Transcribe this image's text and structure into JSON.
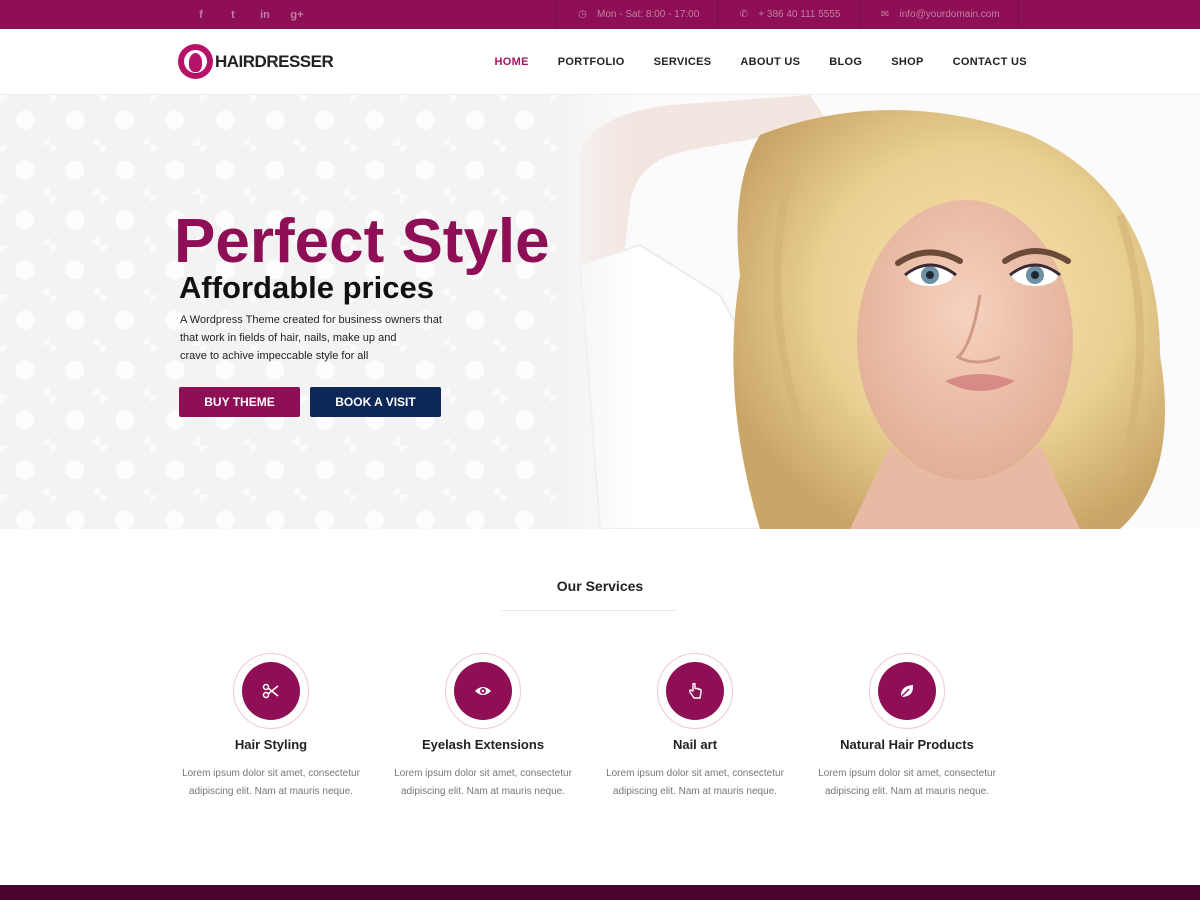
{
  "topbar": {
    "social": [
      {
        "icon": "facebook-icon",
        "glyph": "f"
      },
      {
        "icon": "twitter-icon",
        "glyph": "t"
      },
      {
        "icon": "linkedin-icon",
        "glyph": "in"
      },
      {
        "icon": "google-plus-icon",
        "glyph": "g+"
      }
    ],
    "hours": "Mon - Sat: 8:00 - 17:00",
    "phone": "+ 386 40 111 5555",
    "email": "info@yourdomain.com"
  },
  "header": {
    "logo_text": "HAIRDRESSER",
    "nav": [
      "HOME",
      "PORTFOLIO",
      "SERVICES",
      "ABOUT US",
      "BLOG",
      "SHOP",
      "CONTACT US"
    ],
    "active_nav": "HOME"
  },
  "hero": {
    "title": "Perfect Style",
    "subtitle": "Affordable prices",
    "description_lines": [
      "A Wordpress Theme created for business owners that",
      "that work in fields of hair, nails, make up and",
      "crave to achive impeccable style for all"
    ],
    "buy_button": "BUY THEME",
    "book_button": "BOOK A VISIT"
  },
  "services": {
    "title": "Our Services",
    "items": [
      {
        "icon": "scissors-icon",
        "title": "Hair Styling",
        "text_lines": [
          "Lorem ipsum dolor sit amet, consectetur",
          "adipiscing elit. Nam at mauris neque."
        ]
      },
      {
        "icon": "eye-icon",
        "title": "Eyelash Extensions",
        "text_lines": [
          "Lorem ipsum dolor sit amet, consectetur",
          "adipiscing elit. Nam at mauris neque."
        ]
      },
      {
        "icon": "hand-pointer-icon",
        "title": "Nail art",
        "text_lines": [
          "Lorem ipsum dolor sit amet, consectetur",
          "adipiscing elit. Nam at mauris neque."
        ]
      },
      {
        "icon": "leaf-icon",
        "title": "Natural Hair Products",
        "text_lines": [
          "Lorem ipsum dolor sit amet, consectetur",
          "adipiscing elit. Nam at mauris neque."
        ]
      }
    ]
  },
  "colors": {
    "brand": "#8e0f55",
    "accent_blue": "#0d2858",
    "footer": "#4a0630"
  }
}
